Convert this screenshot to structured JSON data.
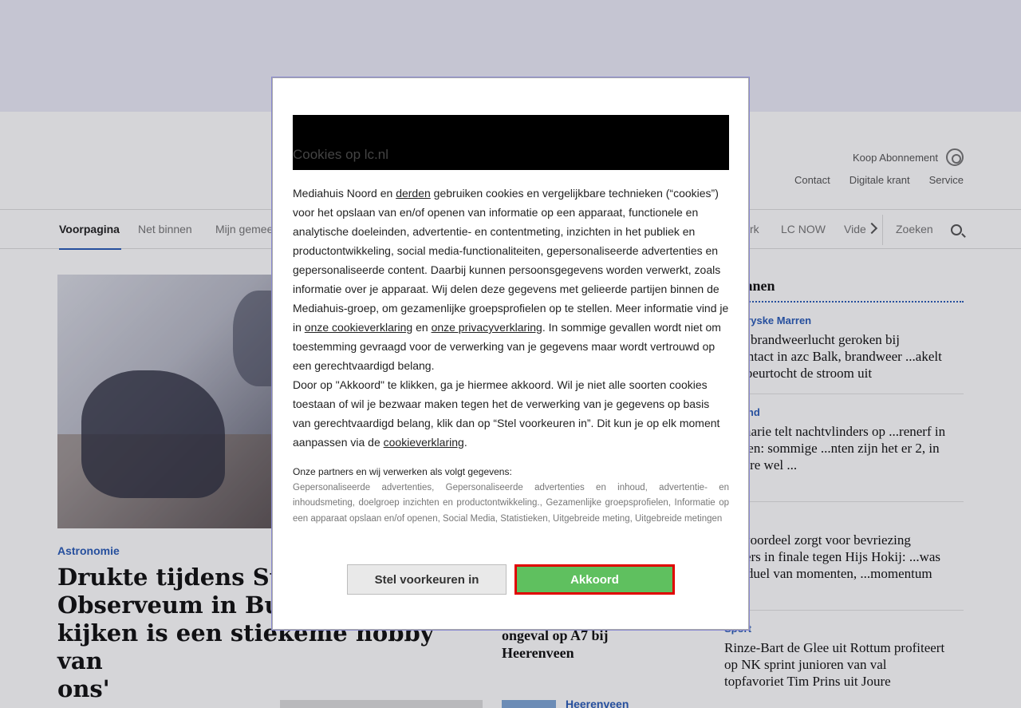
{
  "topbar": {
    "subscribe": "Koop Abonnement",
    "links": [
      "Contact",
      "Digitale krant",
      "Service"
    ]
  },
  "nav": {
    "items": [
      "Voorpagina",
      "Net binnen",
      "Mijn gemeen",
      "rk",
      "LC NOW",
      "Vide"
    ],
    "search_label": "Zoeken"
  },
  "hero": {
    "category": "Astronomie",
    "title": "Drukte tijdens Sterr... Observeum in Burg... kijken is een stiekeme hobby van ons'"
  },
  "hero_lines": [
    "Drukte tijdens Sterr",
    "Observeum in Burg",
    "kijken is een stiekeme hobby van",
    "ons'"
  ],
  "middle": {
    "title_lines": [
      "ongeval op A7 bij",
      "Heerenveen"
    ],
    "category": "Heerenveen"
  },
  "sidebar": {
    "heading": "t binnen",
    "items": [
      {
        "category": "De Fryske Marren",
        "title": "...ke brandweerlucht geroken bij ...contact in azc Balk, brandweer ...akelt na speurtocht de stroom uit"
      },
      {
        "category": "...sland",
        "title": "...emarie telt nachtvlinders op ...renerf in Rutten: sommige ...nten zijn het er 2, in andere wel ..."
      },
      {
        "category": "...t",
        "title": "...isvoordeel zorgt voor bevriezing ...lyers in finale tegen Hijs Hokij: ...was een duel van momenten, ...momentum ook'"
      },
      {
        "category": "Sport",
        "title": "Rinze-Bart de Glee uit Rottum profiteert op NK sprint junioren van val topfavoriet Tim Prins uit Joure"
      }
    ]
  },
  "cookie": {
    "title": "Cookies op lc.nl",
    "p1_a": "Mediahuis Noord en ",
    "link_derden": "derden",
    "p1_b": " gebruiken cookies en vergelijkbare technieken (“cookies”) voor het opslaan van en/of openen van informatie op een apparaat, functionele en analytische doeleinden, advertentie- en contentmeting, inzichten in het publiek en productontwikkeling, social media-functionaliteiten, gepersonaliseerde advertenties en gepersonaliseerde content. Daarbij kunnen persoonsgegevens worden verwerkt, zoals informatie over je apparaat. Wij delen deze gegevens met gelieerde partijen binnen de Mediahuis-groep, om gezamenlijke groepsprofielen op te stellen. Meer informatie vind je in ",
    "link_cookie": "onze cookieverklaring",
    "p1_c": " en ",
    "link_privacy": "onze privacyverklaring",
    "p1_d": ". In sommige gevallen wordt niet om toestemming gevraagd voor de verwerking van je gegevens maar wordt vertrouwd op een gerechtvaardigd belang.",
    "p2_a": "Door op \"Akkoord\" te klikken, ga je hiermee akkoord. Wil je niet alle soorten cookies toestaan of wil je bezwaar maken tegen het de verwerking van je gegevens op basis van gerechtvaardigd belang, klik dan op “Stel voorkeuren in”. Dit kun je op elk moment aanpassen via de ",
    "link_cookie2": "cookieverklaring",
    "p2_b": ".",
    "partners_heading": "Onze partners en wij verwerken als volgt gegevens:",
    "partners_text": "Gepersonaliseerde advertenties, Gepersonaliseerde advertenties en inhoud, advertentie- en inhoudsmeting, doelgroep inzichten en productontwikkeling., Gezamenlijke groepsprofielen, Informatie op een apparaat opslaan en/of openen, Social Media, Statistieken, Uitgebreide meting, Uitgebreide metingen",
    "btn_prefs": "Stel voorkeuren in",
    "btn_accept": "Akkoord"
  },
  "colors": {
    "accent": "#2a5cb8",
    "accept_button": "#5fc05f",
    "accept_border": "#e00000"
  }
}
